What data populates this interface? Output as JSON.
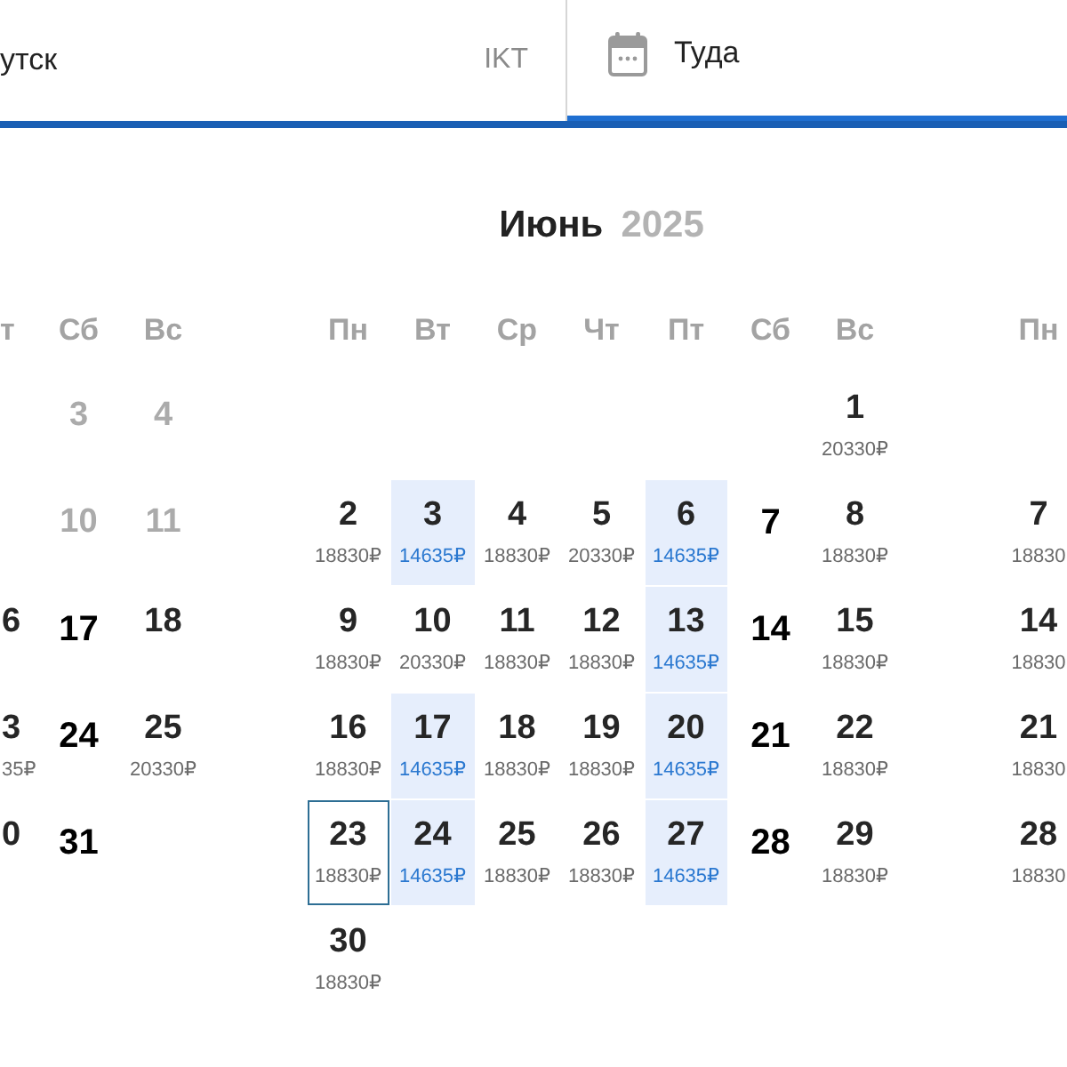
{
  "search_form": {
    "origin": {
      "value": "утск",
      "code": "IKT"
    },
    "date": {
      "placeholder": "Туда",
      "focused": true
    }
  },
  "months": [
    {
      "kind": "previous",
      "weekdays": [
        "т",
        "Сб",
        "Вс"
      ],
      "weeks": [
        [
          {
            "kind": "blank"
          },
          {
            "day": "3",
            "kind": "past"
          },
          {
            "day": "4",
            "kind": "past"
          }
        ],
        [
          {
            "kind": "blank"
          },
          {
            "day": "10",
            "kind": "past"
          },
          {
            "day": "11",
            "kind": "past"
          }
        ],
        [
          {
            "day": "6",
            "kind": "available",
            "cheapest": false,
            "selected": false
          },
          {
            "day": "17",
            "kind": "closed"
          },
          {
            "day": "18",
            "kind": "available",
            "cheapest": false,
            "selected": false
          }
        ],
        [
          {
            "day": "3",
            "kind": "available",
            "price": "35₽",
            "cheapest": false,
            "selected": false
          },
          {
            "day": "24",
            "kind": "closed"
          },
          {
            "day": "25",
            "kind": "available",
            "price": "20330₽",
            "cheapest": false,
            "selected": false
          }
        ],
        [
          {
            "day": "0",
            "kind": "available",
            "cheapest": false,
            "selected": false
          },
          {
            "day": "31",
            "kind": "closed"
          }
        ]
      ]
    },
    {
      "kind": "current",
      "title": {
        "month": "Июнь",
        "year": "2025"
      },
      "weekdays": [
        "Пн",
        "Вт",
        "Ср",
        "Чт",
        "Пт",
        "Сб",
        "Вс"
      ],
      "weeks": [
        [
          {
            "kind": "blank"
          },
          {
            "kind": "blank"
          },
          {
            "kind": "blank"
          },
          {
            "kind": "blank"
          },
          {
            "kind": "blank"
          },
          {
            "kind": "blank"
          },
          {
            "day": "1",
            "kind": "available",
            "price": "20330₽",
            "cheapest": false,
            "selected": false
          }
        ],
        [
          {
            "day": "2",
            "kind": "available",
            "price": "18830₽",
            "cheapest": false,
            "selected": false
          },
          {
            "day": "3",
            "kind": "available",
            "price": "14635₽",
            "cheapest": true,
            "selected": false
          },
          {
            "day": "4",
            "kind": "available",
            "price": "18830₽",
            "cheapest": false,
            "selected": false
          },
          {
            "day": "5",
            "kind": "available",
            "price": "20330₽",
            "cheapest": false,
            "selected": false
          },
          {
            "day": "6",
            "kind": "available",
            "price": "14635₽",
            "cheapest": true,
            "selected": false
          },
          {
            "day": "7",
            "kind": "closed"
          },
          {
            "day": "8",
            "kind": "available",
            "price": "18830₽",
            "cheapest": false,
            "selected": false
          }
        ],
        [
          {
            "day": "9",
            "kind": "available",
            "price": "18830₽",
            "cheapest": false,
            "selected": false
          },
          {
            "day": "10",
            "kind": "available",
            "price": "20330₽",
            "cheapest": false,
            "selected": false
          },
          {
            "day": "11",
            "kind": "available",
            "price": "18830₽",
            "cheapest": false,
            "selected": false
          },
          {
            "day": "12",
            "kind": "available",
            "price": "18830₽",
            "cheapest": false,
            "selected": false
          },
          {
            "day": "13",
            "kind": "available",
            "price": "14635₽",
            "cheapest": true,
            "selected": false
          },
          {
            "day": "14",
            "kind": "closed"
          },
          {
            "day": "15",
            "kind": "available",
            "price": "18830₽",
            "cheapest": false,
            "selected": false
          }
        ],
        [
          {
            "day": "16",
            "kind": "available",
            "price": "18830₽",
            "cheapest": false,
            "selected": false
          },
          {
            "day": "17",
            "kind": "available",
            "price": "14635₽",
            "cheapest": true,
            "selected": false
          },
          {
            "day": "18",
            "kind": "available",
            "price": "18830₽",
            "cheapest": false,
            "selected": false
          },
          {
            "day": "19",
            "kind": "available",
            "price": "18830₽",
            "cheapest": false,
            "selected": false
          },
          {
            "day": "20",
            "kind": "available",
            "price": "14635₽",
            "cheapest": true,
            "selected": false
          },
          {
            "day": "21",
            "kind": "closed"
          },
          {
            "day": "22",
            "kind": "available",
            "price": "18830₽",
            "cheapest": false,
            "selected": false
          }
        ],
        [
          {
            "day": "23",
            "kind": "available",
            "price": "18830₽",
            "cheapest": false,
            "selected": true
          },
          {
            "day": "24",
            "kind": "available",
            "price": "14635₽",
            "cheapest": true,
            "selected": false
          },
          {
            "day": "25",
            "kind": "available",
            "price": "18830₽",
            "cheapest": false,
            "selected": false
          },
          {
            "day": "26",
            "kind": "available",
            "price": "18830₽",
            "cheapest": false,
            "selected": false
          },
          {
            "day": "27",
            "kind": "available",
            "price": "14635₽",
            "cheapest": true,
            "selected": false
          },
          {
            "day": "28",
            "kind": "closed"
          },
          {
            "day": "29",
            "kind": "available",
            "price": "18830₽",
            "cheapest": false,
            "selected": false
          }
        ],
        [
          {
            "day": "30",
            "kind": "available",
            "price": "18830₽",
            "cheapest": false,
            "selected": false
          }
        ]
      ]
    },
    {
      "kind": "next",
      "weekdays": [
        "Пн"
      ],
      "weeks": [
        [
          {
            "kind": "blank"
          }
        ],
        [
          {
            "day": "7",
            "kind": "available",
            "price": "18830",
            "cheapest": false,
            "selected": false
          }
        ],
        [
          {
            "day": "14",
            "kind": "available",
            "price": "18830",
            "cheapest": false,
            "selected": false
          }
        ],
        [
          {
            "day": "21",
            "kind": "available",
            "price": "18830",
            "cheapest": false,
            "selected": false
          }
        ],
        [
          {
            "day": "28",
            "kind": "available",
            "price": "18830",
            "cheapest": false,
            "selected": false
          }
        ]
      ]
    }
  ]
}
